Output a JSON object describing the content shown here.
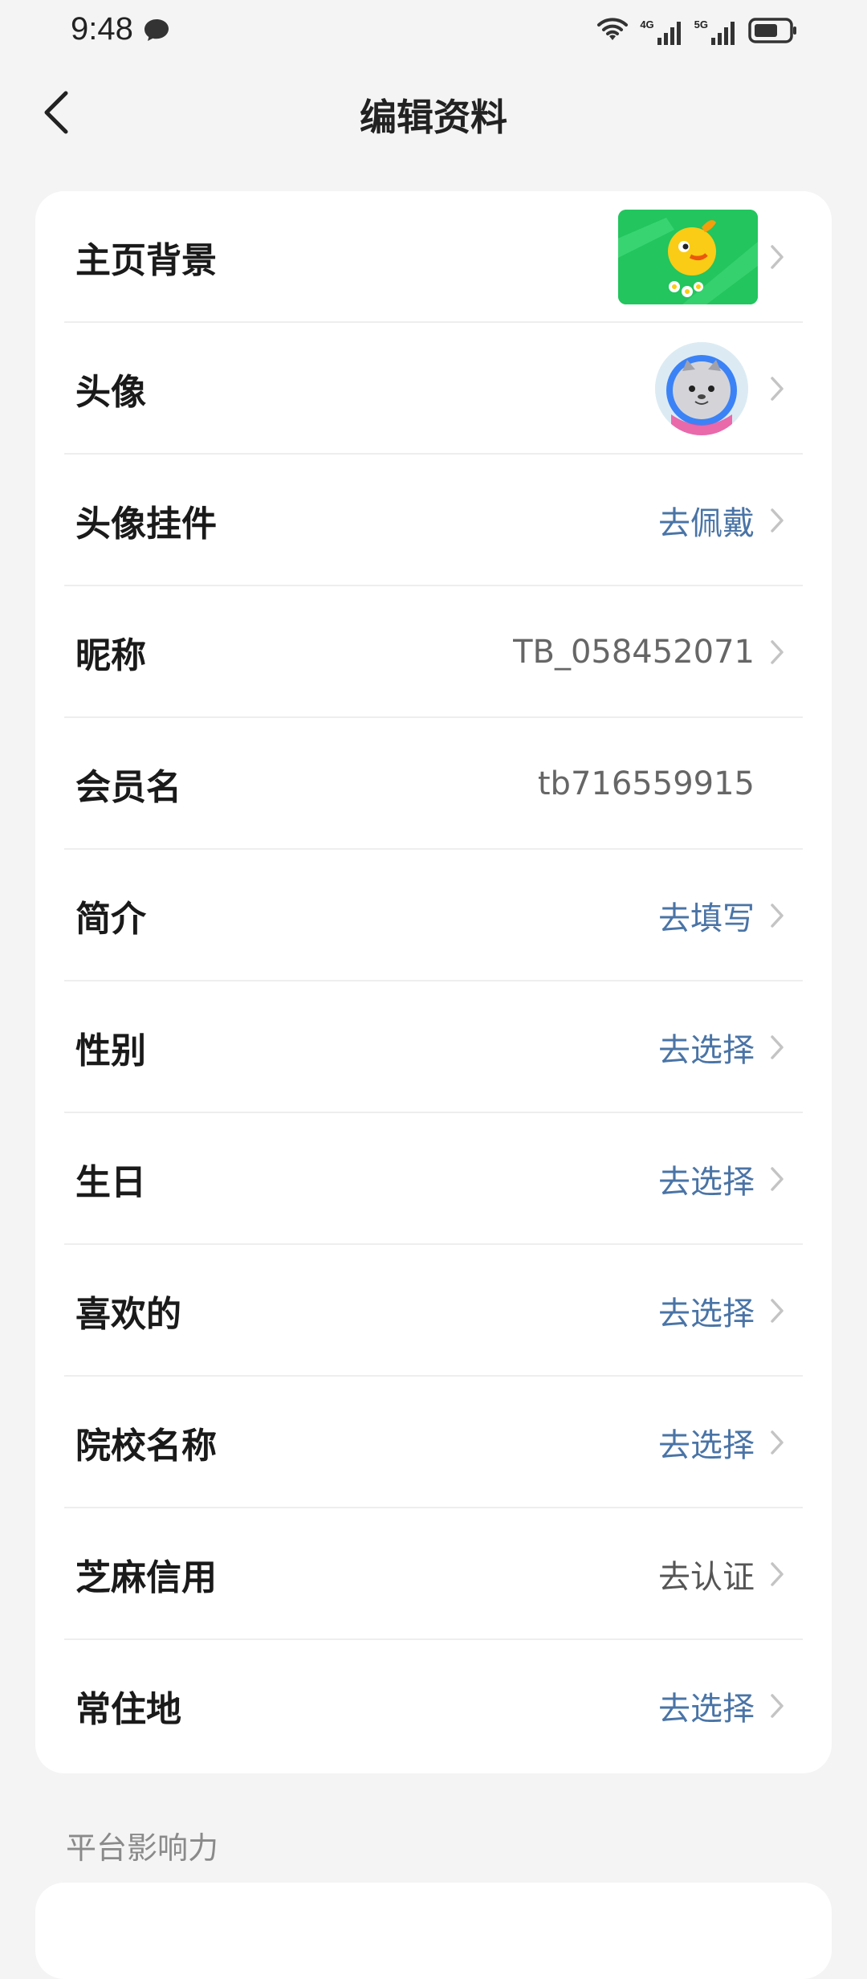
{
  "status": {
    "time": "9:48",
    "net1": "4G",
    "net2": "5G"
  },
  "header": {
    "title": "编辑资料"
  },
  "rows": [
    {
      "label": "主页背景"
    },
    {
      "label": "头像"
    },
    {
      "label": "头像挂件",
      "value": "去佩戴"
    },
    {
      "label": "昵称",
      "value": "TB_058452071"
    },
    {
      "label": "会员名",
      "value": "tb716559915"
    },
    {
      "label": "简介",
      "value": "去填写"
    },
    {
      "label": "性别",
      "value": "去选择"
    },
    {
      "label": "生日",
      "value": "去选择"
    },
    {
      "label": "喜欢的",
      "value": "去选择"
    },
    {
      "label": "院校名称",
      "value": "去选择"
    },
    {
      "label": "芝麻信用",
      "value": "去认证"
    },
    {
      "label": "常住地",
      "value": "去选择"
    }
  ],
  "section": {
    "title": "平台影响力"
  },
  "colors": {
    "link_blue": "#4a74a6",
    "background": "#f4f4f4",
    "card": "#ffffff"
  }
}
